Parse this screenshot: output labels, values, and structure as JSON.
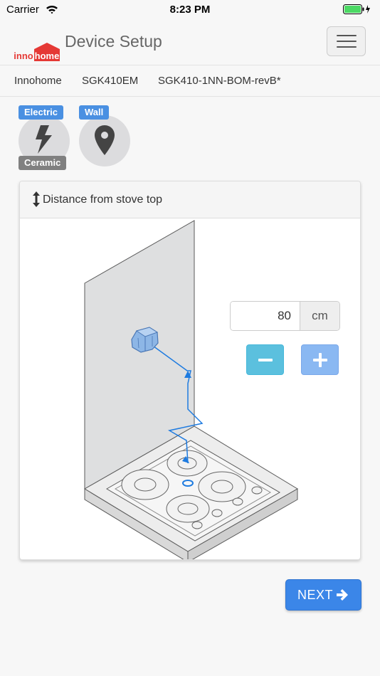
{
  "status_bar": {
    "carrier": "Carrier",
    "time": "8:23 PM"
  },
  "header": {
    "logo_left": "inno",
    "logo_right": "home",
    "title": "Device Setup",
    "brand_color": "#e53935"
  },
  "breadcrumb": [
    "Innohome",
    "SGK410EM",
    "SGK410-1NN-BOM-revB*"
  ],
  "options": {
    "stove_type": {
      "top_badge": "Electric",
      "bottom_badge": "Ceramic",
      "icon": "lightning-icon"
    },
    "placement": {
      "badge": "Wall",
      "icon": "location-pin-icon"
    }
  },
  "card": {
    "title": "Distance from stove top",
    "distance": {
      "value": "80",
      "unit": "cm"
    }
  },
  "footer": {
    "next_label": "NEXT"
  },
  "colors": {
    "accent": "#4a90e2",
    "minus_button": "#5bc0de",
    "plus_button": "#8ab8f2",
    "next_button": "#3b86e8"
  }
}
